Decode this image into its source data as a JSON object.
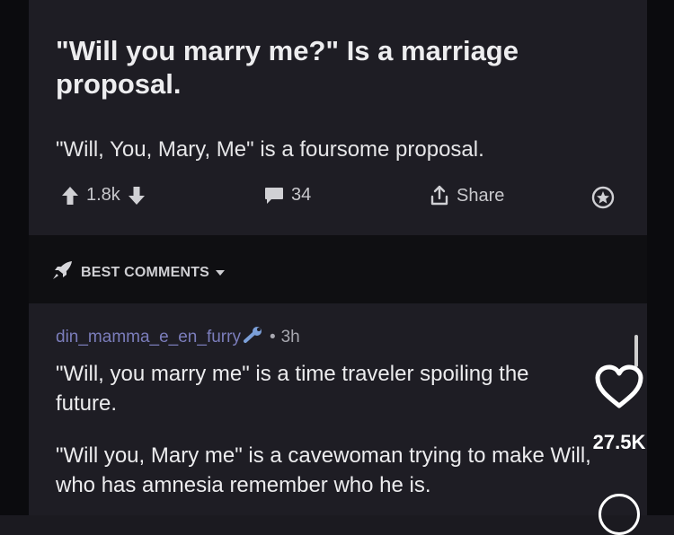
{
  "post": {
    "title": "\"Will you marry me?\" Is a marriage proposal.",
    "body": "\"Will, You, Mary, Me\" is a foursome proposal.",
    "vote_count": "1.8k",
    "comment_count": "34",
    "share_label": "Share"
  },
  "sort": {
    "label": "BEST COMMENTS"
  },
  "comment": {
    "username": "din_mamma_e_en_furry",
    "separator": "•",
    "time": "3h",
    "paragraph1": "\"Will, you marry me\" is a time traveler spoiling the future.",
    "paragraph2": "\"Will you, Mary me\" is a cavewoman trying to make Will, who has amnesia remember who he is."
  },
  "overlay": {
    "like_count": "27.5K"
  },
  "icons": {
    "upvote": "arrow-up-icon",
    "downvote": "arrow-down-icon",
    "comments": "speech-bubble-icon",
    "share": "share-icon",
    "award": "award-icon",
    "sort": "rocket-icon",
    "flair": "wrench-icon",
    "like": "heart-icon"
  },
  "colors": {
    "username": "#7b7dbb",
    "card_bg": "#1e1d24",
    "divider_bg": "#0f0f12"
  }
}
